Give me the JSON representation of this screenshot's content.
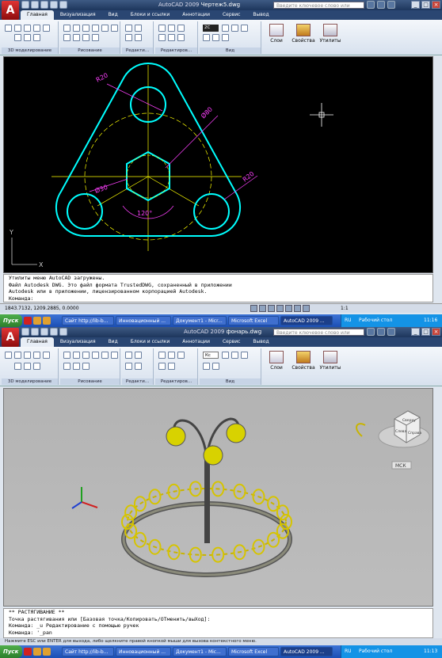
{
  "window1": {
    "title_app": "AutoCAD 2009",
    "title_file": "Чертеж5.dwg",
    "search_placeholder": "Введите ключевое слово или фразу",
    "tabs": [
      "Главная",
      "Визуализация",
      "Вид",
      "Блоки и ссылки",
      "Аннотации",
      "Сервис",
      "Вывод"
    ],
    "panels": [
      "3D моделирование",
      "Рисование",
      "Редакти...",
      "Редактиров...",
      "Вид"
    ],
    "big_buttons": [
      "Слои",
      "Свойства",
      "Утилиты"
    ],
    "layer_color": "2С",
    "dimensions": {
      "r20": "R20",
      "d80": "Ø80",
      "r20b": "R20",
      "d30": "Ø30",
      "angle": "120°"
    },
    "ucs": {
      "x": "X",
      "y": "Y"
    },
    "command_lines": [
      "Утилиты меню AutoCAD загружены.",
      "Файл Autodesk DWG. Это файл формата TrustedDWG, сохраненный в приложении",
      "Autodesk или в приложении, лицензированном корпорацией Autodesk.",
      "Команда:"
    ],
    "coords": "1843.7132, 1209.2885, 0.0000",
    "zoom": "1:1"
  },
  "taskbar1": {
    "start": "Пуск",
    "items": [
      "Сайт http://lib-b...",
      "Инновационный ...",
      "Документ1 - Micr...",
      "Microsoft Excel",
      "AutoCAD 2009 ..."
    ],
    "lang": "RU",
    "desktop": "Рабочий стол",
    "time": "11:16"
  },
  "window2": {
    "title_app": "AutoCAD 2009",
    "title_file": "фонарь.dwg",
    "search_placeholder": "Введите ключевое слово или фразу",
    "tabs": [
      "Главная",
      "Визуализация",
      "Вид",
      "Блоки и ссылки",
      "Аннотации",
      "Сервис",
      "Вывод"
    ],
    "panels": [
      "3D моделирование",
      "Рисование",
      "Редакти...",
      "Редактиров...",
      "Вид"
    ],
    "big_buttons": [
      "Слои",
      "Свойства",
      "Утилиты"
    ],
    "layer_color": "Кс",
    "viewcube": {
      "faces": [
        "Сверху",
        "Справа",
        "Слева"
      ],
      "wcs": "МСК"
    },
    "command_lines": [
      "** РАСТЯГИВАНИЕ **",
      "Точка растягивания или [Базовая точка/Копировать/ОТменить/выХод]:",
      "Команда: _u Редактирование с помощью ручек",
      "Команда: '_pan"
    ],
    "status_hint": "Нажмите ESC или ENTER для выхода, либо щелкните правой кнопкой мыши для вызова контекстного меню."
  },
  "taskbar2": {
    "start": "Пуск",
    "items": [
      "Сайт http://lib-b...",
      "Инновационный ...",
      "Документ1 - Mic...",
      "Microsoft Excel",
      "AutoCAD 2009 ..."
    ],
    "lang": "RU",
    "desktop": "Рабочий стол",
    "time": "11:13"
  },
  "colors": {
    "cyan": "#00ffff",
    "yellow": "#ffff00",
    "magenta": "#ff40ff",
    "title": "#1d365c"
  }
}
